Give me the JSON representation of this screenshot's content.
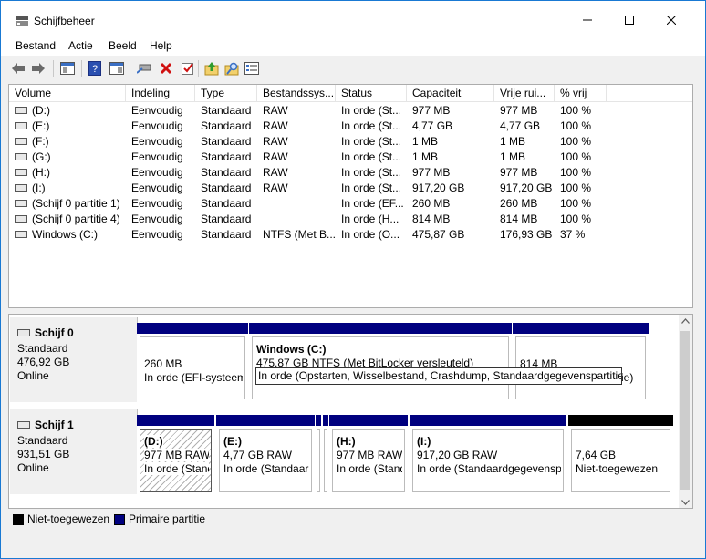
{
  "window": {
    "title": "Schijfbeheer"
  },
  "menu": [
    "Bestand",
    "Actie",
    "Beeld",
    "Help"
  ],
  "icons": {
    "toolbar": [
      "back-icon",
      "forward-icon",
      "console-tree-icon",
      "help-icon",
      "show-action-pane-icon",
      "connect-drive-icon",
      "delete-icon",
      "check-icon",
      "folder-up-icon",
      "search-folder-icon",
      "properties-icon"
    ]
  },
  "list": {
    "columns": [
      "Volume",
      "Indeling",
      "Type",
      "Bestandssys...",
      "Status",
      "Capaciteit",
      "Vrije rui...",
      "% vrij"
    ],
    "rows": [
      [
        "(D:)",
        "Eenvoudig",
        "Standaard",
        "RAW",
        "In orde (St...",
        "977 MB",
        "977 MB",
        "100 %"
      ],
      [
        "(E:)",
        "Eenvoudig",
        "Standaard",
        "RAW",
        "In orde (St...",
        "4,77 GB",
        "4,77 GB",
        "100 %"
      ],
      [
        "(F:)",
        "Eenvoudig",
        "Standaard",
        "RAW",
        "In orde (St...",
        "1 MB",
        "1 MB",
        "100 %"
      ],
      [
        "(G:)",
        "Eenvoudig",
        "Standaard",
        "RAW",
        "In orde (St...",
        "1 MB",
        "1 MB",
        "100 %"
      ],
      [
        "(H:)",
        "Eenvoudig",
        "Standaard",
        "RAW",
        "In orde (St...",
        "977 MB",
        "977 MB",
        "100 %"
      ],
      [
        "(I:)",
        "Eenvoudig",
        "Standaard",
        "RAW",
        "In orde (St...",
        "917,20 GB",
        "917,20 GB",
        "100 %"
      ],
      [
        "(Schijf 0 partitie 1)",
        "Eenvoudig",
        "Standaard",
        "",
        "In orde (EF...",
        "260 MB",
        "260 MB",
        "100 %"
      ],
      [
        "(Schijf 0 partitie 4)",
        "Eenvoudig",
        "Standaard",
        "",
        "In orde (H...",
        "814 MB",
        "814 MB",
        "100 %"
      ],
      [
        "Windows  (C:)",
        "Eenvoudig",
        "Standaard",
        "NTFS (Met B...",
        "In orde (O...",
        "475,87 GB",
        "176,93 GB",
        "37 %"
      ]
    ]
  },
  "disks": [
    {
      "name": "Schijf 0",
      "type": "Standaard",
      "size": "476,92 GB",
      "state": "Online",
      "partitions": [
        {
          "title": "",
          "line1": "260 MB",
          "line2": "In orde (EFI-systeem",
          "kind": "primary"
        },
        {
          "title": "Windows  (C:)",
          "line1": "475,87 GB NTFS (Met BitLocker versleuteld)",
          "line2": "In orde (Opstarten, Wisselbestand, Crashdump, Standaardgegevenspartitie)",
          "kind": "primary"
        },
        {
          "title": "",
          "line1": "814 MB",
          "line2": "ie)",
          "kind": "primary"
        }
      ]
    },
    {
      "name": "Schijf 1",
      "type": "Standaard",
      "size": "931,51 GB",
      "state": "Online",
      "partitions": [
        {
          "title": "(D:)",
          "line1": "977 MB RAW",
          "line2": "In orde (Standaa",
          "kind": "primary-selected"
        },
        {
          "title": "(E:)",
          "line1": "4,77 GB RAW",
          "line2": "In orde (Standaar",
          "kind": "primary"
        },
        {
          "title": "",
          "line1": "",
          "line2": "",
          "kind": "primary"
        },
        {
          "title": "",
          "line1": "",
          "line2": "",
          "kind": "primary"
        },
        {
          "title": "(H:)",
          "line1": "977 MB RAW",
          "line2": "In orde (Standaa",
          "kind": "primary"
        },
        {
          "title": "(I:)",
          "line1": "917,20 GB RAW",
          "line2": "In orde (Standaardgegevenspa",
          "kind": "primary"
        },
        {
          "title": "",
          "line1": "7,64 GB",
          "line2": "Niet-toegewezen",
          "kind": "unallocated"
        }
      ]
    }
  ],
  "legend": [
    {
      "label": "Niet-toegewezen",
      "color": "#000000"
    },
    {
      "label": "Primaire partitie",
      "color": "#00007f"
    }
  ],
  "colors": {
    "primary": "#00007f",
    "unallocated": "#000000",
    "titlebar": "#ffffff",
    "border": "#1979d3"
  }
}
